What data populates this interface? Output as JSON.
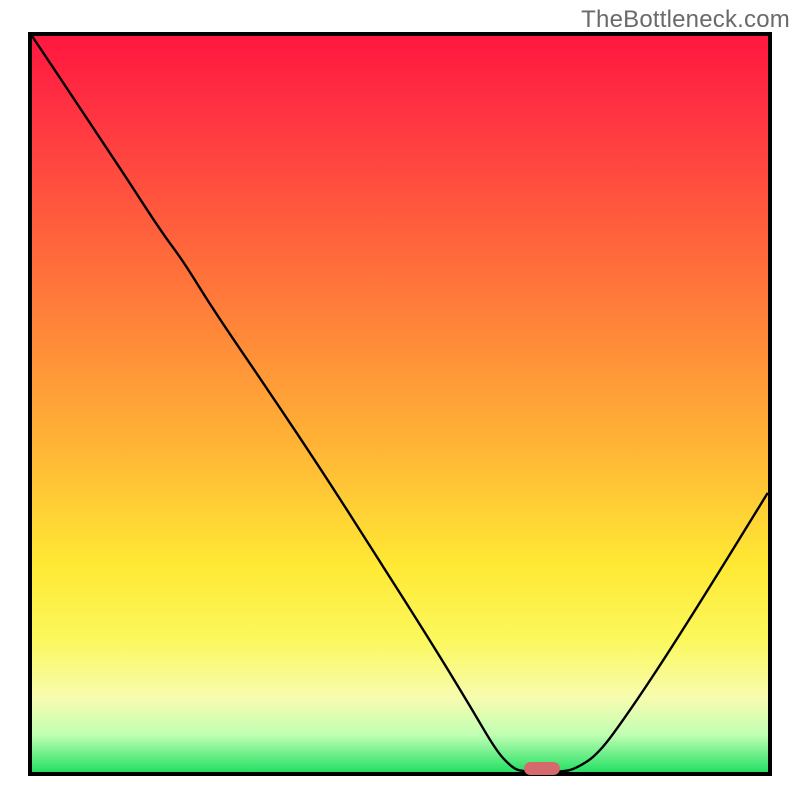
{
  "watermark": "TheBottleneck.com",
  "chart_data": {
    "type": "line",
    "title": "",
    "xlabel": "",
    "ylabel": "",
    "x_range": [
      0,
      1
    ],
    "y_range": [
      0,
      1
    ],
    "curve": [
      {
        "x": 0.0,
        "y": 1.0
      },
      {
        "x": 0.06,
        "y": 0.91
      },
      {
        "x": 0.12,
        "y": 0.82
      },
      {
        "x": 0.175,
        "y": 0.735
      },
      {
        "x": 0.205,
        "y": 0.695
      },
      {
        "x": 0.245,
        "y": 0.63
      },
      {
        "x": 0.32,
        "y": 0.52
      },
      {
        "x": 0.4,
        "y": 0.4
      },
      {
        "x": 0.47,
        "y": 0.29
      },
      {
        "x": 0.54,
        "y": 0.18
      },
      {
        "x": 0.595,
        "y": 0.09
      },
      {
        "x": 0.63,
        "y": 0.03
      },
      {
        "x": 0.65,
        "y": 0.008
      },
      {
        "x": 0.665,
        "y": 0.0
      },
      {
        "x": 0.72,
        "y": 0.0
      },
      {
        "x": 0.74,
        "y": 0.005
      },
      {
        "x": 0.77,
        "y": 0.025
      },
      {
        "x": 0.81,
        "y": 0.08
      },
      {
        "x": 0.86,
        "y": 0.155
      },
      {
        "x": 0.92,
        "y": 0.25
      },
      {
        "x": 1.0,
        "y": 0.38
      }
    ],
    "optimum_marker": {
      "x": 0.693,
      "y": 0.0
    },
    "gradient_stops": [
      {
        "pos": 0.0,
        "color": "#ff173f"
      },
      {
        "pos": 0.1,
        "color": "#ff3242"
      },
      {
        "pos": 0.3,
        "color": "#ff6a3b"
      },
      {
        "pos": 0.55,
        "color": "#ffb236"
      },
      {
        "pos": 0.72,
        "color": "#ffe934"
      },
      {
        "pos": 0.82,
        "color": "#fbf85d"
      },
      {
        "pos": 0.9,
        "color": "#f7fcb0"
      },
      {
        "pos": 0.95,
        "color": "#bfffb2"
      },
      {
        "pos": 1.0,
        "color": "#24e064"
      }
    ]
  }
}
